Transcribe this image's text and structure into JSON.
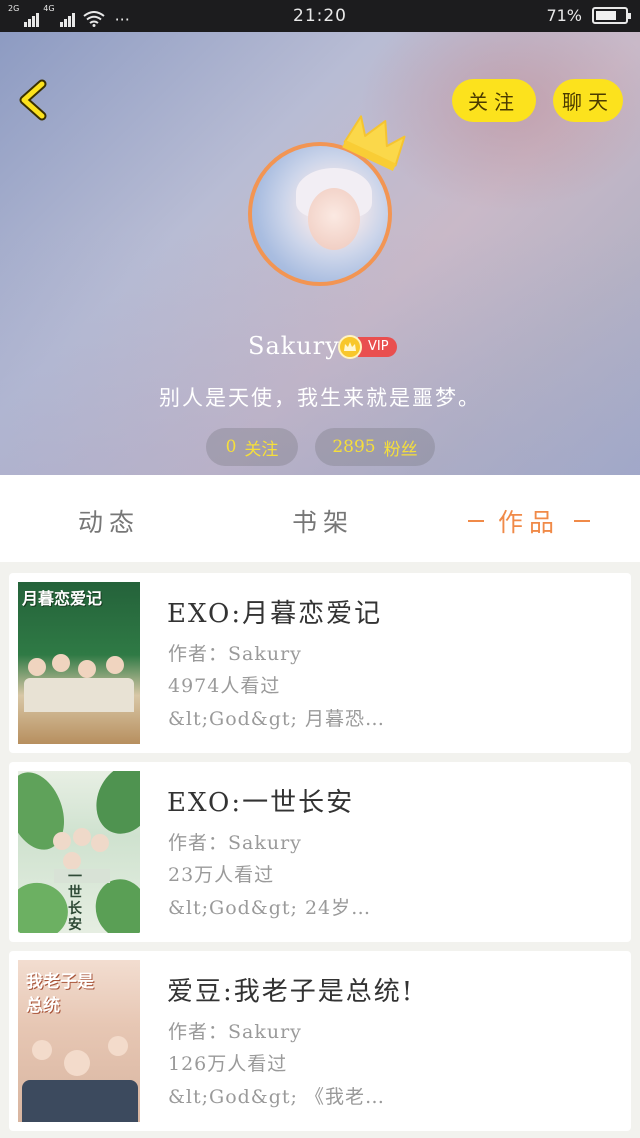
{
  "status_bar": {
    "network_1": "2G",
    "network_2": "4G",
    "more": "···",
    "time": "21:20",
    "battery_percent": "71%",
    "battery_level": 0.71
  },
  "header": {
    "follow_label": "关注",
    "chat_label": "聊天",
    "username": "Sakury",
    "vip_label": "VIP",
    "bio": "别人是天使，我生来就是噩梦。",
    "following_count": "0",
    "following_label": "关注",
    "fans_count": "2895",
    "fans_label": "粉丝"
  },
  "tabs": [
    {
      "label": "动态"
    },
    {
      "label": "书架"
    },
    {
      "label": "作品",
      "active": true
    }
  ],
  "works": [
    {
      "title": "EXO:月暮恋爱记",
      "author": "作者：Sakury",
      "views": "4974人看过",
      "excerpt": "&lt;God&gt; 月暮恐…",
      "cover_text": "月暮恋爱记"
    },
    {
      "title": "EXO:一世长安",
      "author": "作者：Sakury",
      "views": "23万人看过",
      "excerpt": "&lt;God&gt; 24岁…",
      "cover_text": "一世长安"
    },
    {
      "title": "爱豆:我老子是总统!",
      "author": "作者：Sakury",
      "views": "126万人看过",
      "excerpt": "&lt;God&gt; 《我老…",
      "cover_text": "我老子是总统"
    }
  ],
  "colors": {
    "accent_yellow": "#fce21d",
    "active_tab": "#f08a48",
    "avatar_ring": "#f29553",
    "vip_red": "#e94f4f"
  }
}
